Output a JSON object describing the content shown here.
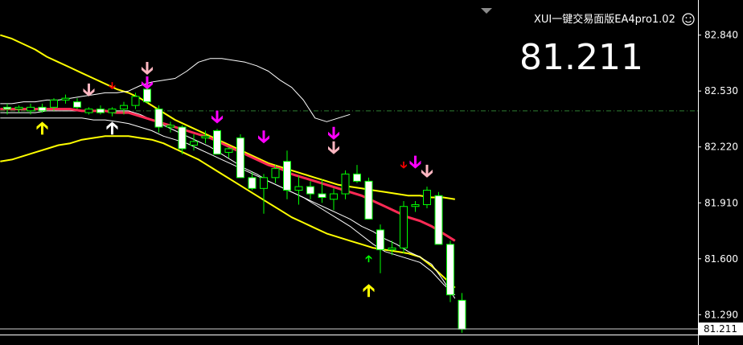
{
  "header": {
    "ea_title": "XUI一键交易面版EA4pro1.02",
    "smiley": "☺",
    "big_price": "81.211"
  },
  "colors": {
    "background": "#000000",
    "candle_bull_border": "#00ff00",
    "candle_bear_fill": "#ffffff",
    "ma_line": "#ff2a55",
    "envelope_line": "#ffff00",
    "bollinger_line": "#ffffff",
    "grid_line": "#2e7d32",
    "arrow_yellow": "#ffff00",
    "arrow_pink": "#ffb6c1",
    "arrow_magenta": "#ff00ff",
    "arrow_red": "#ff0000",
    "arrow_green": "#00ff00"
  },
  "chart_data": {
    "type": "candlestick",
    "y_axis": {
      "ticks": [
        "82.840",
        "82.530",
        "82.220",
        "81.910",
        "81.600",
        "81.290"
      ],
      "range": [
        81.18,
        82.99
      ],
      "current_price_label": "81.211"
    },
    "horizontal_line": {
      "value": 82.42,
      "style": "dash-dot"
    },
    "candles": [
      {
        "o": 82.44,
        "h": 82.46,
        "l": 82.4,
        "c": 82.43
      },
      {
        "o": 82.43,
        "h": 82.45,
        "l": 82.41,
        "c": 82.44
      },
      {
        "o": 82.42,
        "h": 82.46,
        "l": 82.4,
        "c": 82.44
      },
      {
        "o": 82.44,
        "h": 82.46,
        "l": 82.41,
        "c": 82.42
      },
      {
        "o": 82.44,
        "h": 82.49,
        "l": 82.42,
        "c": 82.48
      },
      {
        "o": 82.48,
        "h": 82.51,
        "l": 82.46,
        "c": 82.49
      },
      {
        "o": 82.47,
        "h": 82.49,
        "l": 82.43,
        "c": 82.44
      },
      {
        "o": 82.41,
        "h": 82.44,
        "l": 82.4,
        "c": 82.43
      },
      {
        "o": 82.43,
        "h": 82.45,
        "l": 82.4,
        "c": 82.41
      },
      {
        "o": 82.41,
        "h": 82.44,
        "l": 82.39,
        "c": 82.43
      },
      {
        "o": 82.43,
        "h": 82.47,
        "l": 82.4,
        "c": 82.45
      },
      {
        "o": 82.45,
        "h": 82.52,
        "l": 82.43,
        "c": 82.5
      },
      {
        "o": 82.54,
        "h": 82.57,
        "l": 82.46,
        "c": 82.47
      },
      {
        "o": 82.43,
        "h": 82.45,
        "l": 82.3,
        "c": 82.33
      },
      {
        "o": 82.33,
        "h": 82.36,
        "l": 82.3,
        "c": 82.34
      },
      {
        "o": 82.33,
        "h": 82.34,
        "l": 82.18,
        "c": 82.21
      },
      {
        "o": 82.23,
        "h": 82.29,
        "l": 82.2,
        "c": 82.25
      },
      {
        "o": 82.27,
        "h": 82.31,
        "l": 82.24,
        "c": 82.28
      },
      {
        "o": 82.31,
        "h": 82.32,
        "l": 82.2,
        "c": 82.18
      },
      {
        "o": 82.19,
        "h": 82.22,
        "l": 82.16,
        "c": 82.21
      },
      {
        "o": 82.27,
        "h": 82.29,
        "l": 82.05,
        "c": 82.05
      },
      {
        "o": 82.05,
        "h": 82.08,
        "l": 81.98,
        "c": 81.99
      },
      {
        "o": 81.99,
        "h": 82.07,
        "l": 81.85,
        "c": 82.05
      },
      {
        "o": 82.05,
        "h": 82.12,
        "l": 82.02,
        "c": 82.1
      },
      {
        "o": 82.14,
        "h": 82.2,
        "l": 81.93,
        "c": 81.98
      },
      {
        "o": 81.98,
        "h": 82.06,
        "l": 81.9,
        "c": 82.0
      },
      {
        "o": 82.0,
        "h": 82.03,
        "l": 81.93,
        "c": 81.96
      },
      {
        "o": 81.96,
        "h": 82.04,
        "l": 81.91,
        "c": 81.94
      },
      {
        "o": 81.93,
        "h": 81.99,
        "l": 81.87,
        "c": 81.96
      },
      {
        "o": 81.96,
        "h": 82.09,
        "l": 81.93,
        "c": 82.07
      },
      {
        "o": 82.07,
        "h": 82.12,
        "l": 82.02,
        "c": 82.03
      },
      {
        "o": 82.03,
        "h": 82.05,
        "l": 81.82,
        "c": 81.82
      },
      {
        "o": 81.76,
        "h": 81.79,
        "l": 81.52,
        "c": 81.65
      },
      {
        "o": 81.65,
        "h": 81.7,
        "l": 81.62,
        "c": 81.66
      },
      {
        "o": 81.66,
        "h": 81.92,
        "l": 81.63,
        "c": 81.89
      },
      {
        "o": 81.89,
        "h": 81.92,
        "l": 81.86,
        "c": 81.9
      },
      {
        "o": 81.9,
        "h": 82.0,
        "l": 81.88,
        "c": 81.98
      },
      {
        "o": 81.95,
        "h": 81.97,
        "l": 81.68,
        "c": 81.68
      },
      {
        "o": 81.68,
        "h": 81.7,
        "l": 81.36,
        "c": 81.4
      },
      {
        "o": 81.37,
        "h": 81.41,
        "l": 81.19,
        "c": 81.21
      }
    ],
    "ma_line": [
      82.43,
      82.43,
      82.43,
      82.43,
      82.43,
      82.43,
      82.43,
      82.42,
      82.42,
      82.42,
      82.41,
      82.41,
      82.39,
      82.37,
      82.35,
      82.33,
      82.31,
      82.29,
      82.27,
      82.24,
      82.21,
      82.18,
      82.15,
      82.12,
      82.1,
      82.07,
      82.05,
      82.03,
      82.01,
      81.99,
      81.97,
      81.95,
      81.92,
      81.89,
      81.86,
      81.83,
      81.81,
      81.78,
      81.74,
      81.7
    ],
    "upper_envelope": [
      82.84,
      82.82,
      82.79,
      82.76,
      82.72,
      82.69,
      82.66,
      82.63,
      82.6,
      82.57,
      82.54,
      82.52,
      82.49,
      82.45,
      82.41,
      82.37,
      82.34,
      82.31,
      82.28,
      82.25,
      82.22,
      82.19,
      82.16,
      82.13,
      82.11,
      82.09,
      82.07,
      82.05,
      82.03,
      82.01,
      82.0,
      81.99,
      81.98,
      81.97,
      81.96,
      81.95,
      81.95,
      81.94,
      81.94,
      81.93
    ],
    "lower_envelope": [
      82.14,
      82.15,
      82.17,
      82.19,
      82.21,
      82.23,
      82.24,
      82.26,
      82.27,
      82.28,
      82.28,
      82.28,
      82.27,
      82.26,
      82.24,
      82.21,
      82.18,
      82.15,
      82.11,
      82.07,
      82.03,
      81.99,
      81.95,
      81.91,
      81.87,
      81.83,
      81.8,
      81.77,
      81.74,
      81.72,
      81.7,
      81.68,
      81.66,
      81.65,
      81.64,
      81.63,
      81.61,
      81.56,
      81.5,
      81.44
    ],
    "bollinger_upper": [
      82.46,
      82.46,
      82.47,
      82.47,
      82.48,
      82.48,
      82.49,
      82.5,
      82.51,
      82.52,
      82.52,
      82.53,
      82.56,
      82.58,
      82.59,
      82.6,
      82.64,
      82.69,
      82.71,
      82.71,
      82.7,
      82.69,
      82.67,
      82.64,
      82.59,
      82.55,
      82.48,
      82.38,
      82.36,
      82.38,
      82.4
    ],
    "bollinger_mid": [
      82.41,
      82.41,
      82.41,
      82.41,
      82.42,
      82.42,
      82.42,
      82.42,
      82.42,
      82.42,
      82.42,
      82.42,
      82.4,
      82.37,
      82.34,
      82.31,
      82.28,
      82.25,
      82.22,
      82.18,
      82.14,
      82.1,
      82.07,
      82.03,
      82.0,
      81.97,
      81.94,
      81.9,
      81.86,
      81.82,
      81.78,
      81.73,
      81.68,
      81.64,
      81.62,
      81.6,
      81.58,
      81.53,
      81.46,
      81.4
    ],
    "bollinger_lower": [
      82.38,
      82.38,
      82.38,
      82.38,
      82.38,
      82.38,
      82.38,
      82.38,
      82.37,
      82.37,
      82.36,
      82.35,
      82.33,
      82.31,
      82.28,
      82.26,
      82.24,
      82.21,
      82.18,
      82.15,
      82.12,
      82.09,
      82.06,
      82.03,
      82.0,
      81.97,
      81.94,
      81.91,
      81.88,
      81.85,
      81.82,
      81.78,
      81.75,
      81.71,
      81.68,
      81.64,
      81.61,
      81.57,
      81.48,
      81.38
    ],
    "signal_arrows": [
      {
        "i": 3,
        "dir": "up",
        "color": "yellow",
        "value": 82.36
      },
      {
        "i": 7,
        "dir": "down",
        "color": "pink",
        "value": 82.5
      },
      {
        "i": 9,
        "dir": "down",
        "color": "red",
        "value": 82.54
      },
      {
        "i": 9,
        "dir": "up",
        "color": "white",
        "value": 82.36
      },
      {
        "i": 12,
        "dir": "down",
        "color": "pink",
        "value": 82.62
      },
      {
        "i": 12,
        "dir": "down",
        "color": "magenta",
        "value": 82.54
      },
      {
        "i": 18,
        "dir": "down",
        "color": "magenta",
        "value": 82.35
      },
      {
        "i": 22,
        "dir": "down",
        "color": "magenta",
        "value": 82.24
      },
      {
        "i": 28,
        "dir": "down",
        "color": "magenta",
        "value": 82.26
      },
      {
        "i": 28,
        "dir": "down",
        "color": "pink",
        "value": 82.18
      },
      {
        "i": 31,
        "dir": "up",
        "color": "yellow",
        "value": 81.46
      },
      {
        "i": 31,
        "dir": "up",
        "color": "green",
        "value": 81.62
      },
      {
        "i": 34,
        "dir": "down",
        "color": "red",
        "value": 82.1
      },
      {
        "i": 35,
        "dir": "down",
        "color": "magenta",
        "value": 82.1
      },
      {
        "i": 36,
        "dir": "down",
        "color": "pink",
        "value": 82.05
      }
    ]
  }
}
